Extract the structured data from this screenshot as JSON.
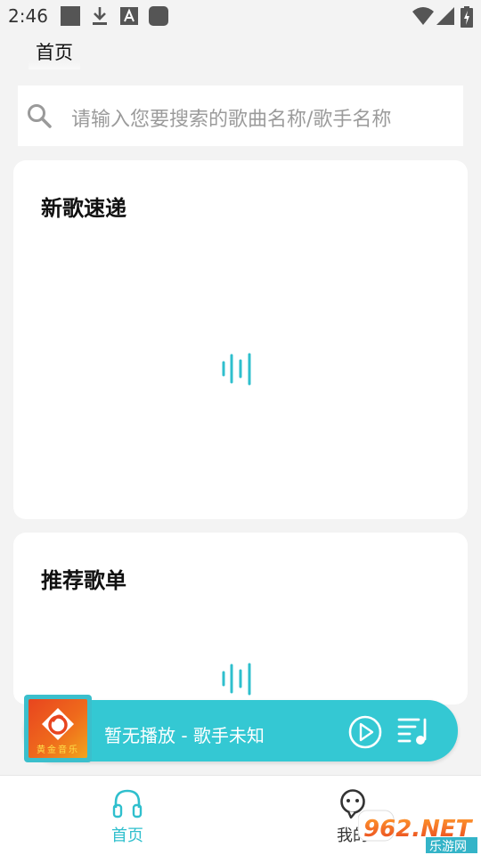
{
  "status_bar": {
    "time": "2:46",
    "icons_left": [
      "square-icon",
      "download-icon",
      "a-icon",
      "rounded-square-icon"
    ],
    "icons_right": [
      "wifi-icon",
      "signal-icon",
      "battery-icon"
    ]
  },
  "header": {
    "title": "首页"
  },
  "search": {
    "placeholder": "请输入您要搜索的歌曲名称/歌手名称",
    "icon": "search-icon"
  },
  "sections": [
    {
      "title": "新歌速递",
      "loading": true
    },
    {
      "title": "推荐歌单",
      "loading": true
    }
  ],
  "player": {
    "cover_text": "黄金音乐",
    "now_playing": "暂无播放 - 歌手未知",
    "accent": "#34c8d3"
  },
  "bottom_nav": {
    "items": [
      {
        "label": "首页",
        "icon": "headphones-icon",
        "active": true
      },
      {
        "label": "我的",
        "icon": "chat-face-icon",
        "active": false
      }
    ]
  },
  "watermark": {
    "text": "962.NET",
    "subtext": "乐游网"
  }
}
